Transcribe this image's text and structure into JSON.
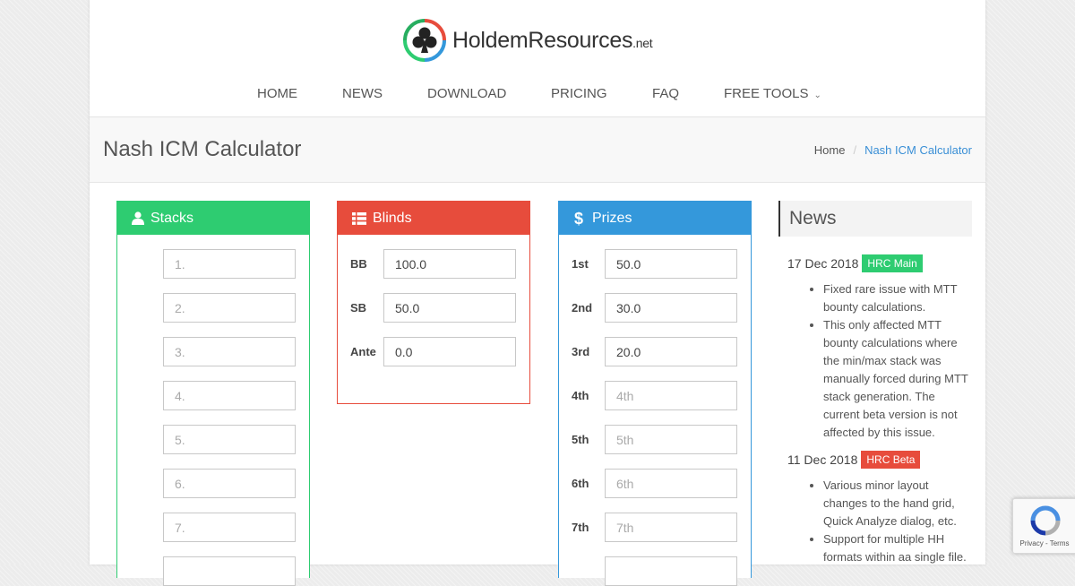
{
  "site": {
    "logo_name": "HoldemResources",
    "logo_tld": ".net"
  },
  "nav": [
    {
      "label": "HOME"
    },
    {
      "label": "NEWS"
    },
    {
      "label": "DOWNLOAD"
    },
    {
      "label": "PRICING"
    },
    {
      "label": "FAQ"
    },
    {
      "label": "FREE TOOLS"
    }
  ],
  "page": {
    "title": "Nash ICM Calculator"
  },
  "breadcrumb": {
    "home": "Home",
    "separator": "/",
    "current": "Nash ICM Calculator"
  },
  "stacks": {
    "title": "Stacks",
    "color": "#2ecc71",
    "icon": "user-icon",
    "placeholders": [
      "1.",
      "2.",
      "3.",
      "4.",
      "5.",
      "6.",
      "7."
    ]
  },
  "blinds": {
    "title": "Blinds",
    "color": "#e74c3c",
    "icon": "list-icon",
    "rows": [
      {
        "label": "BB",
        "value": "100.0"
      },
      {
        "label": "SB",
        "value": "50.0"
      },
      {
        "label": "Ante",
        "value": "0.0"
      }
    ]
  },
  "prizes": {
    "title": "Prizes",
    "color": "#3498db",
    "icon": "dollar-icon",
    "rows": [
      {
        "label": "1st",
        "value": "50.0",
        "placeholder": ""
      },
      {
        "label": "2nd",
        "value": "30.0",
        "placeholder": ""
      },
      {
        "label": "3rd",
        "value": "20.0",
        "placeholder": ""
      },
      {
        "label": "4th",
        "value": "",
        "placeholder": "4th"
      },
      {
        "label": "5th",
        "value": "",
        "placeholder": "5th"
      },
      {
        "label": "6th",
        "value": "",
        "placeholder": "6th"
      },
      {
        "label": "7th",
        "value": "",
        "placeholder": "7th"
      }
    ]
  },
  "news": {
    "title": "News",
    "entries": [
      {
        "date": "17 Dec 2018",
        "badge": "HRC Main",
        "badge_color": "#2ecc71",
        "items": [
          "Fixed rare issue with MTT bounty calculations.",
          "This only affected MTT bounty calculations where the min/max stack was manually forced during MTT stack generation. The current beta version is not affected by this issue."
        ]
      },
      {
        "date": "11 Dec 2018",
        "badge": "HRC Beta",
        "badge_color": "#e74c3c",
        "items": [
          "Various minor layout changes to the hand grid, Quick Analyze dialog, etc.",
          "Support for multiple HH formats within aa single file."
        ]
      }
    ]
  },
  "recaptcha": {
    "links": "Privacy - Terms"
  }
}
